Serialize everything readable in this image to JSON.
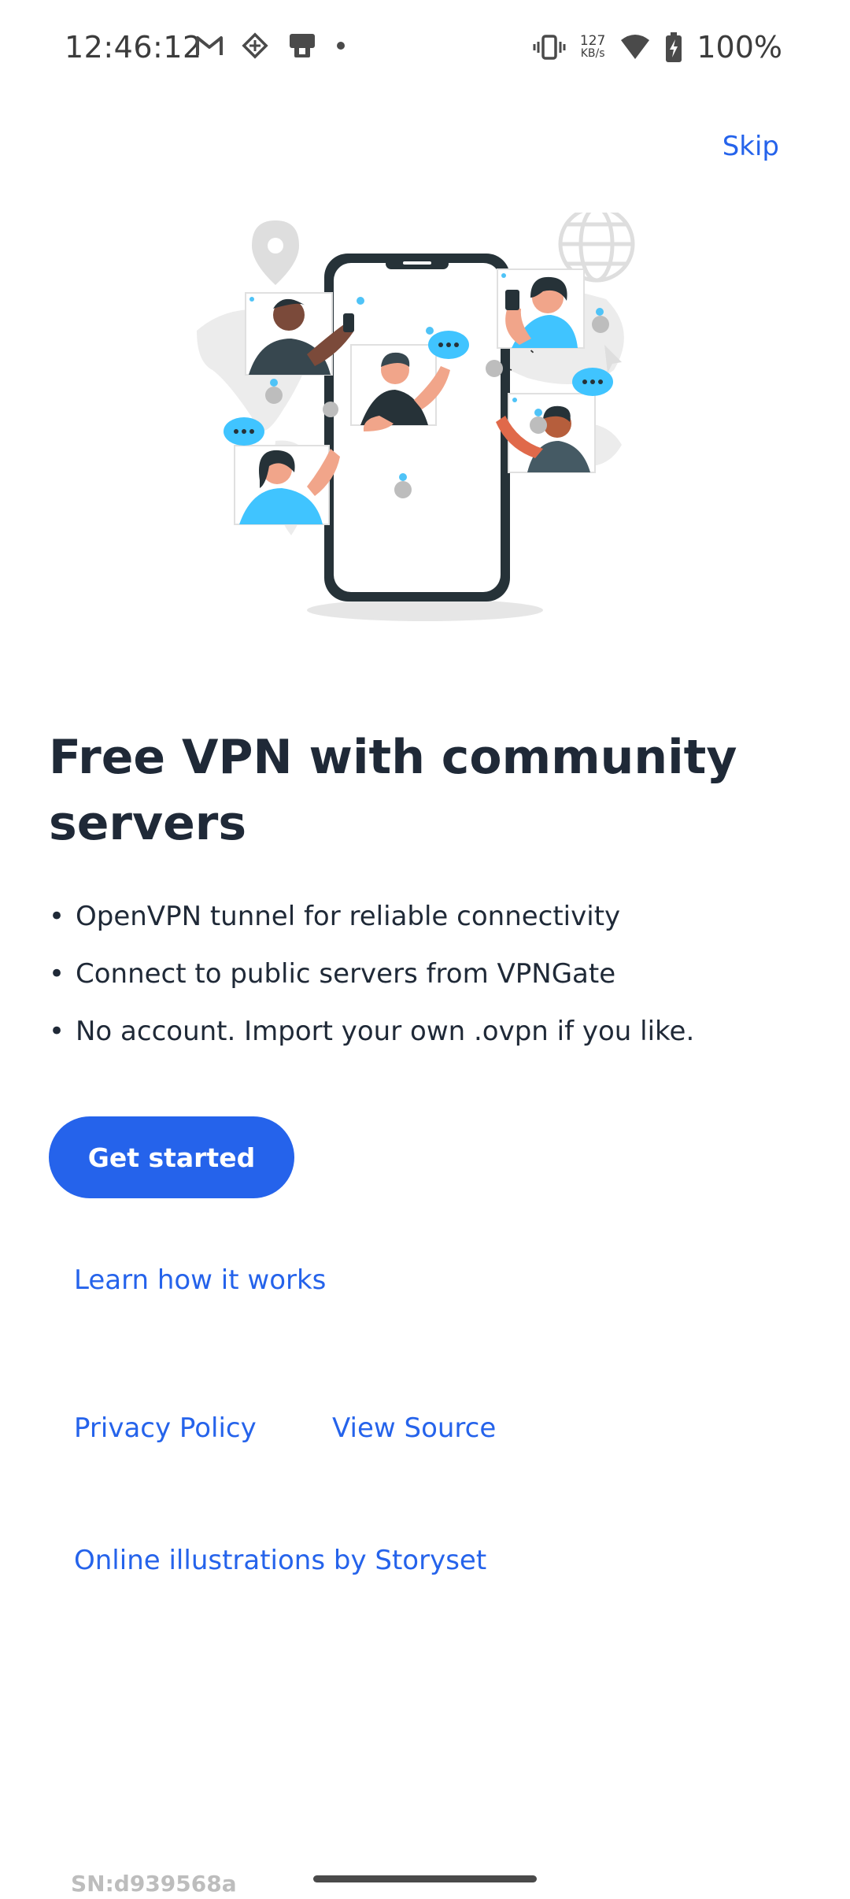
{
  "status_bar": {
    "time": "12:46:12",
    "left_icons": [
      "gmail-icon",
      "nfc-diamond-icon",
      "vpn-phone-icon",
      "dot-icon"
    ],
    "net_speed_value": "127",
    "net_speed_unit": "KB/s",
    "battery_percent": "100%"
  },
  "header": {
    "skip_label": "Skip"
  },
  "illustration": {
    "description_icon": "community-vpn-illustration"
  },
  "main": {
    "headline": "Free VPN with community servers",
    "features": [
      "OpenVPN tunnel for reliable connectivity",
      "Connect to public servers from VPNGate",
      "No account. Import your own .ovpn if you like."
    ],
    "get_started_label": "Get started",
    "learn_link": "Learn how it works",
    "privacy_link": "Privacy Policy",
    "source_link": "View Source",
    "storyset_link": "Online illustrations by Storyset"
  },
  "footer": {
    "serial": "SN:d939568a"
  },
  "colors": {
    "accent": "#2563eb",
    "text": "#1f2937",
    "status": "#3c3c3c"
  }
}
